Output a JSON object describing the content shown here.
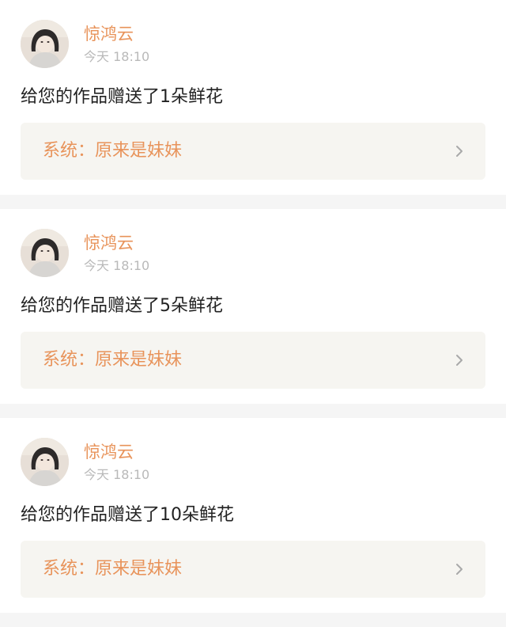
{
  "notifications": [
    {
      "username": "惊鸿云",
      "time": "今天 18:10",
      "message": "给您的作品赠送了1朵鲜花",
      "system_label": "系统：原来是妹妹",
      "avatar_icon": "user-avatar"
    },
    {
      "username": "惊鸿云",
      "time": "今天 18:10",
      "message": "给您的作品赠送了5朵鲜花",
      "system_label": "系统：原来是妹妹",
      "avatar_icon": "user-avatar"
    },
    {
      "username": "惊鸿云",
      "time": "今天 18:10",
      "message": "给您的作品赠送了10朵鲜花",
      "system_label": "系统：原来是妹妹",
      "avatar_icon": "user-avatar"
    }
  ],
  "colors": {
    "accent": "#e8935a",
    "muted": "#b9b9b9",
    "text": "#222222",
    "system_box_bg": "#f6f5f1",
    "divider_bg": "#f5f5f5"
  }
}
